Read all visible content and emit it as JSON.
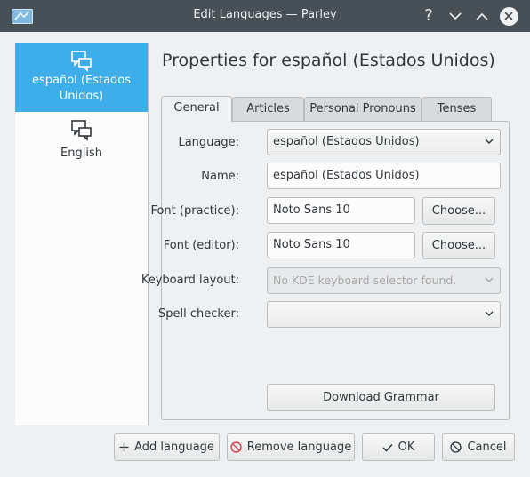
{
  "window": {
    "title": "Edit Languages — Parley",
    "help_glyph": "?",
    "icon": "parley-app-icon"
  },
  "languages": [
    {
      "label": "español (Estados Unidos)",
      "icon": "speech-bubbles-icon",
      "selected": true
    },
    {
      "label": "English",
      "icon": "speech-bubbles-icon",
      "selected": false
    }
  ],
  "properties": {
    "title": "Properties for español (Estados Unidos)",
    "tabs": [
      {
        "label": "General",
        "active": true
      },
      {
        "label": "Articles",
        "active": false
      },
      {
        "label": "Personal Pronouns",
        "active": false
      },
      {
        "label": "Tenses",
        "active": false
      }
    ],
    "general": {
      "language_label": "Language:",
      "language_value": "español (Estados Unidos)",
      "name_label": "Name:",
      "name_value": "español (Estados Unidos)",
      "font_practice_label": "Font (practice):",
      "font_practice_value": "Noto Sans 10",
      "font_editor_label": "Font (editor):",
      "font_editor_value": "Noto Sans 10",
      "choose_label": "Choose...",
      "keyboard_label": "Keyboard layout:",
      "keyboard_value": "No KDE keyboard selector found.",
      "spell_label": "Spell checker:",
      "spell_value": "",
      "download_grammar_label": "Download Grammar"
    }
  },
  "buttons": {
    "add_language": "Add language",
    "remove_language": "Remove language",
    "ok": "OK",
    "cancel": "Cancel"
  },
  "colors": {
    "selection": "#3daee9",
    "titlebar": "#475057",
    "remove_icon": "#da4453"
  }
}
